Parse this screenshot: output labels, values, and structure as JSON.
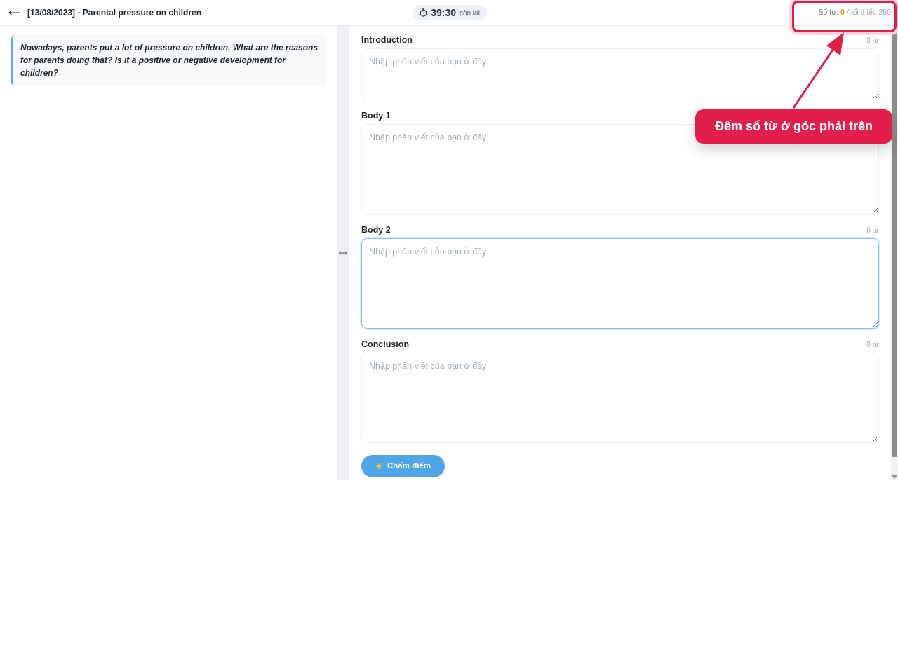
{
  "header": {
    "title": "[13/08/2023] - Parental pressure on children",
    "timer": {
      "time": "39:30",
      "suffix": "còn lại"
    },
    "word_count": {
      "label": "Số từ:",
      "count": "0",
      "minimum": "/ tối thiểu 250"
    }
  },
  "prompt": {
    "text": "Nowadays, parents put a lot of pressure on children. What are the reasons for parents doing that? Is it a positive or negative development for children?"
  },
  "sections": [
    {
      "label": "Introduction",
      "word_count": "0 từ",
      "placeholder": "Nhập phần viết của bạn ở đây",
      "focused": false
    },
    {
      "label": "Body 1",
      "placeholder": "Nhập phần viết của bạn ở đây",
      "focused": false
    },
    {
      "label": "Body 2",
      "word_count": "0 từ",
      "placeholder": "Nhập phần viết của bạn ở đây",
      "focused": true
    },
    {
      "label": "Conclusion",
      "word_count": "0 từ",
      "placeholder": "Nhập phần viết của bạn ở đây",
      "focused": false
    }
  ],
  "submit_button": {
    "label": "Chấm điểm"
  },
  "annotation": {
    "text": "Đếm số từ ở góc phải trên"
  }
}
